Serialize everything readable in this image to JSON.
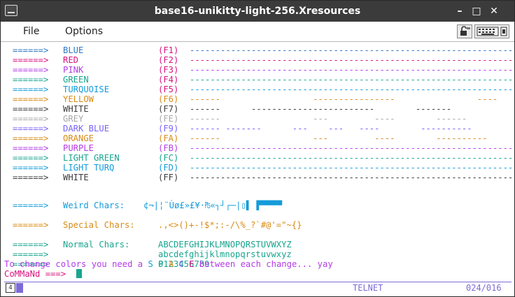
{
  "window": {
    "title": "base16-unikitty-light-256.Xresources",
    "controls": {
      "minimize": "–",
      "maximize": "□",
      "close": "✕"
    }
  },
  "menubar": {
    "file": "File",
    "options": "Options"
  },
  "colors": {
    "blue": "#2e78c2",
    "red": "#d8137f",
    "pink": "#b33ce8",
    "green": "#18a58e",
    "turquoise": "#149bda",
    "yellow": "#d88b16",
    "white": "#3c3c3c",
    "grey": "#a7a7a7",
    "dark_blue": "#7864fa",
    "orange": "#d88b16",
    "purple": "#b33ce8",
    "light_green": "#18a58e",
    "light_turq": "#149bda",
    "accent": "#7c6bd6"
  },
  "color_rows": [
    {
      "arrow": "======>",
      "name": "BLUE",
      "key": "(F1)",
      "dashes": "--------------------------------------------------------------------------------------",
      "color": "#2e78c2",
      "key_color": "#d8137f"
    },
    {
      "arrow": "======>",
      "name": "RED",
      "key": "(F2)",
      "dashes": "--------------------------------------------------------------------------------------",
      "color": "#d8137f",
      "key_color": "#d8137f"
    },
    {
      "arrow": "======>",
      "name": "PINK",
      "key": "(F3)",
      "dashes": "--------------------------------------------------------------------------------------",
      "color": "#b33ce8",
      "key_color": "#d8137f"
    },
    {
      "arrow": "======>",
      "name": "GREEN",
      "key": "(F4)",
      "dashes": "--------------------------------------------------------------------------------------",
      "color": "#18a58e",
      "key_color": "#d8137f"
    },
    {
      "arrow": "======>",
      "name": "TURQUOISE",
      "key": "(F5)",
      "dashes": "--------------------------------------------------------------------------------------",
      "color": "#149bda",
      "key_color": "#d8137f"
    },
    {
      "arrow": "======>",
      "name": "YELLOW",
      "key": "(F6)",
      "dashes": "------                  ----------------                ----",
      "color": "#d88b16",
      "key_color": "#d88b16"
    },
    {
      "arrow": "======>",
      "name": "WHITE",
      "key": "(F7)",
      "dashes": "------      ------------------------        -------",
      "color": "#3c3c3c",
      "key_color": "#3c3c3c"
    },
    {
      "arrow": "======>",
      "name": "GREY",
      "key": "(FE)",
      "dashes": "------                  ---         ----        ------",
      "color": "#a7a7a7",
      "key_color": "#a7a7a7"
    },
    {
      "arrow": "======>",
      "name": "DARK BLUE",
      "key": "(F9)",
      "dashes": "------ -------      ---    ---   ----        ----------",
      "color": "#7864fa",
      "key_color": "#7864fa"
    },
    {
      "arrow": "======>",
      "name": "ORANGE",
      "key": "(FA)",
      "dashes": "------                  ---         ----        ----------",
      "color": "#d88b16",
      "key_color": "#d88b16"
    },
    {
      "arrow": "======>",
      "name": "PURPLE",
      "key": "(FB)",
      "dashes": "--------------------------------------------------------------------------------------",
      "color": "#b33ce8",
      "key_color": "#b33ce8"
    },
    {
      "arrow": "======>",
      "name": "LIGHT GREEN",
      "key": "(FC)",
      "dashes": "--------------------------------------------------------------------------------------",
      "color": "#18a58e",
      "key_color": "#18a58e"
    },
    {
      "arrow": "======>",
      "name": "LIGHT TURQ",
      "key": "(FD)",
      "dashes": "--------------------------------------------------------------------------------------",
      "color": "#149bda",
      "key_color": "#149bda"
    },
    {
      "arrow": "======>",
      "name": "WHITE",
      "key": "(FF)",
      "dashes": "--------------------------------------------------------------------------------------",
      "color": "#3c3c3c",
      "key_color": "#3c3c3c"
    }
  ],
  "weird": {
    "arrow": "======>",
    "label": "Weird Chars:",
    "chars": "¢¬|¦¨Ùø£»£¥·₧«┐┘┌─|▯▌ ▛▀▀▀▀",
    "color": "#149bda"
  },
  "special": {
    "arrow": "======>",
    "label": "Special Chars:",
    "chars": ".,<>()+-!$*;:-/\\%_?`#@'=\"~{}",
    "color": "#d88b16"
  },
  "normal": {
    "arrow": "======>",
    "label": "Normal Chars:",
    "upper": "ABCDEFGHIJKLMNOPQRSTUVWXYZ",
    "lower": "abcdefghijklmnopqrstuvwxyz",
    "digits": "0123456789",
    "color": "#18a58e"
  },
  "message": {
    "before": "To change colors you need a ",
    "s": "S",
    "p": "P",
    "a": "A",
    "c": "C",
    "e": "E",
    "after": " between each change... yay"
  },
  "command": {
    "prompt": "CoMMaNd ===>"
  },
  "status": {
    "icon": "4",
    "protocol": "TELNET",
    "position": "024/016"
  }
}
